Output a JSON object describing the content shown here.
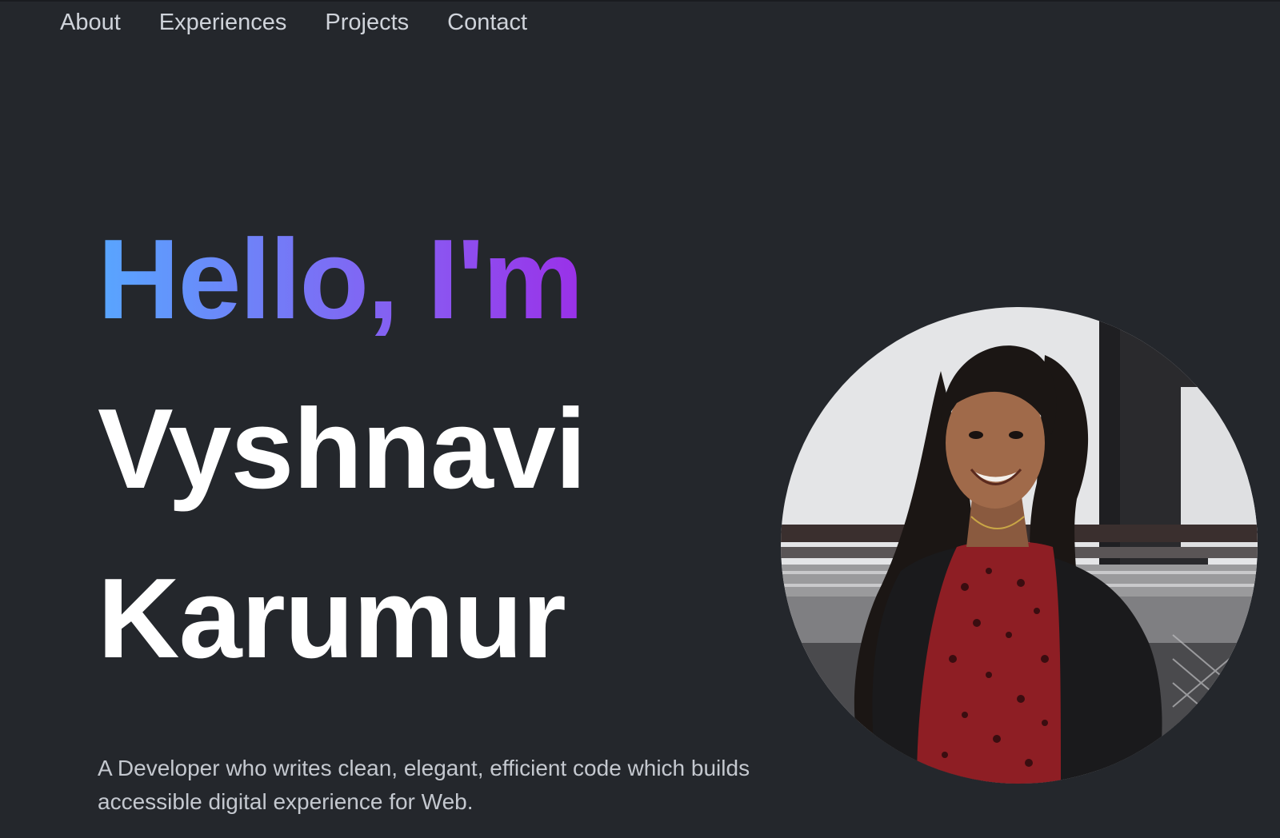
{
  "nav": {
    "items": [
      {
        "label": "About"
      },
      {
        "label": "Experiences"
      },
      {
        "label": "Projects"
      },
      {
        "label": "Contact"
      }
    ]
  },
  "hero": {
    "greeting": "Hello, I'm",
    "first_name": "Vyshnavi",
    "last_name": "Karumur",
    "tagline": "A Developer who writes clean, elegant, efficient code which builds accessible digital experience for Web."
  },
  "colors": {
    "background": "#24272c",
    "gradient_start": "#58a6ff",
    "gradient_end": "#9a30e8",
    "name": "#ffffff",
    "nav_text": "#cfd3da",
    "tagline_text": "#c4c8cf"
  }
}
